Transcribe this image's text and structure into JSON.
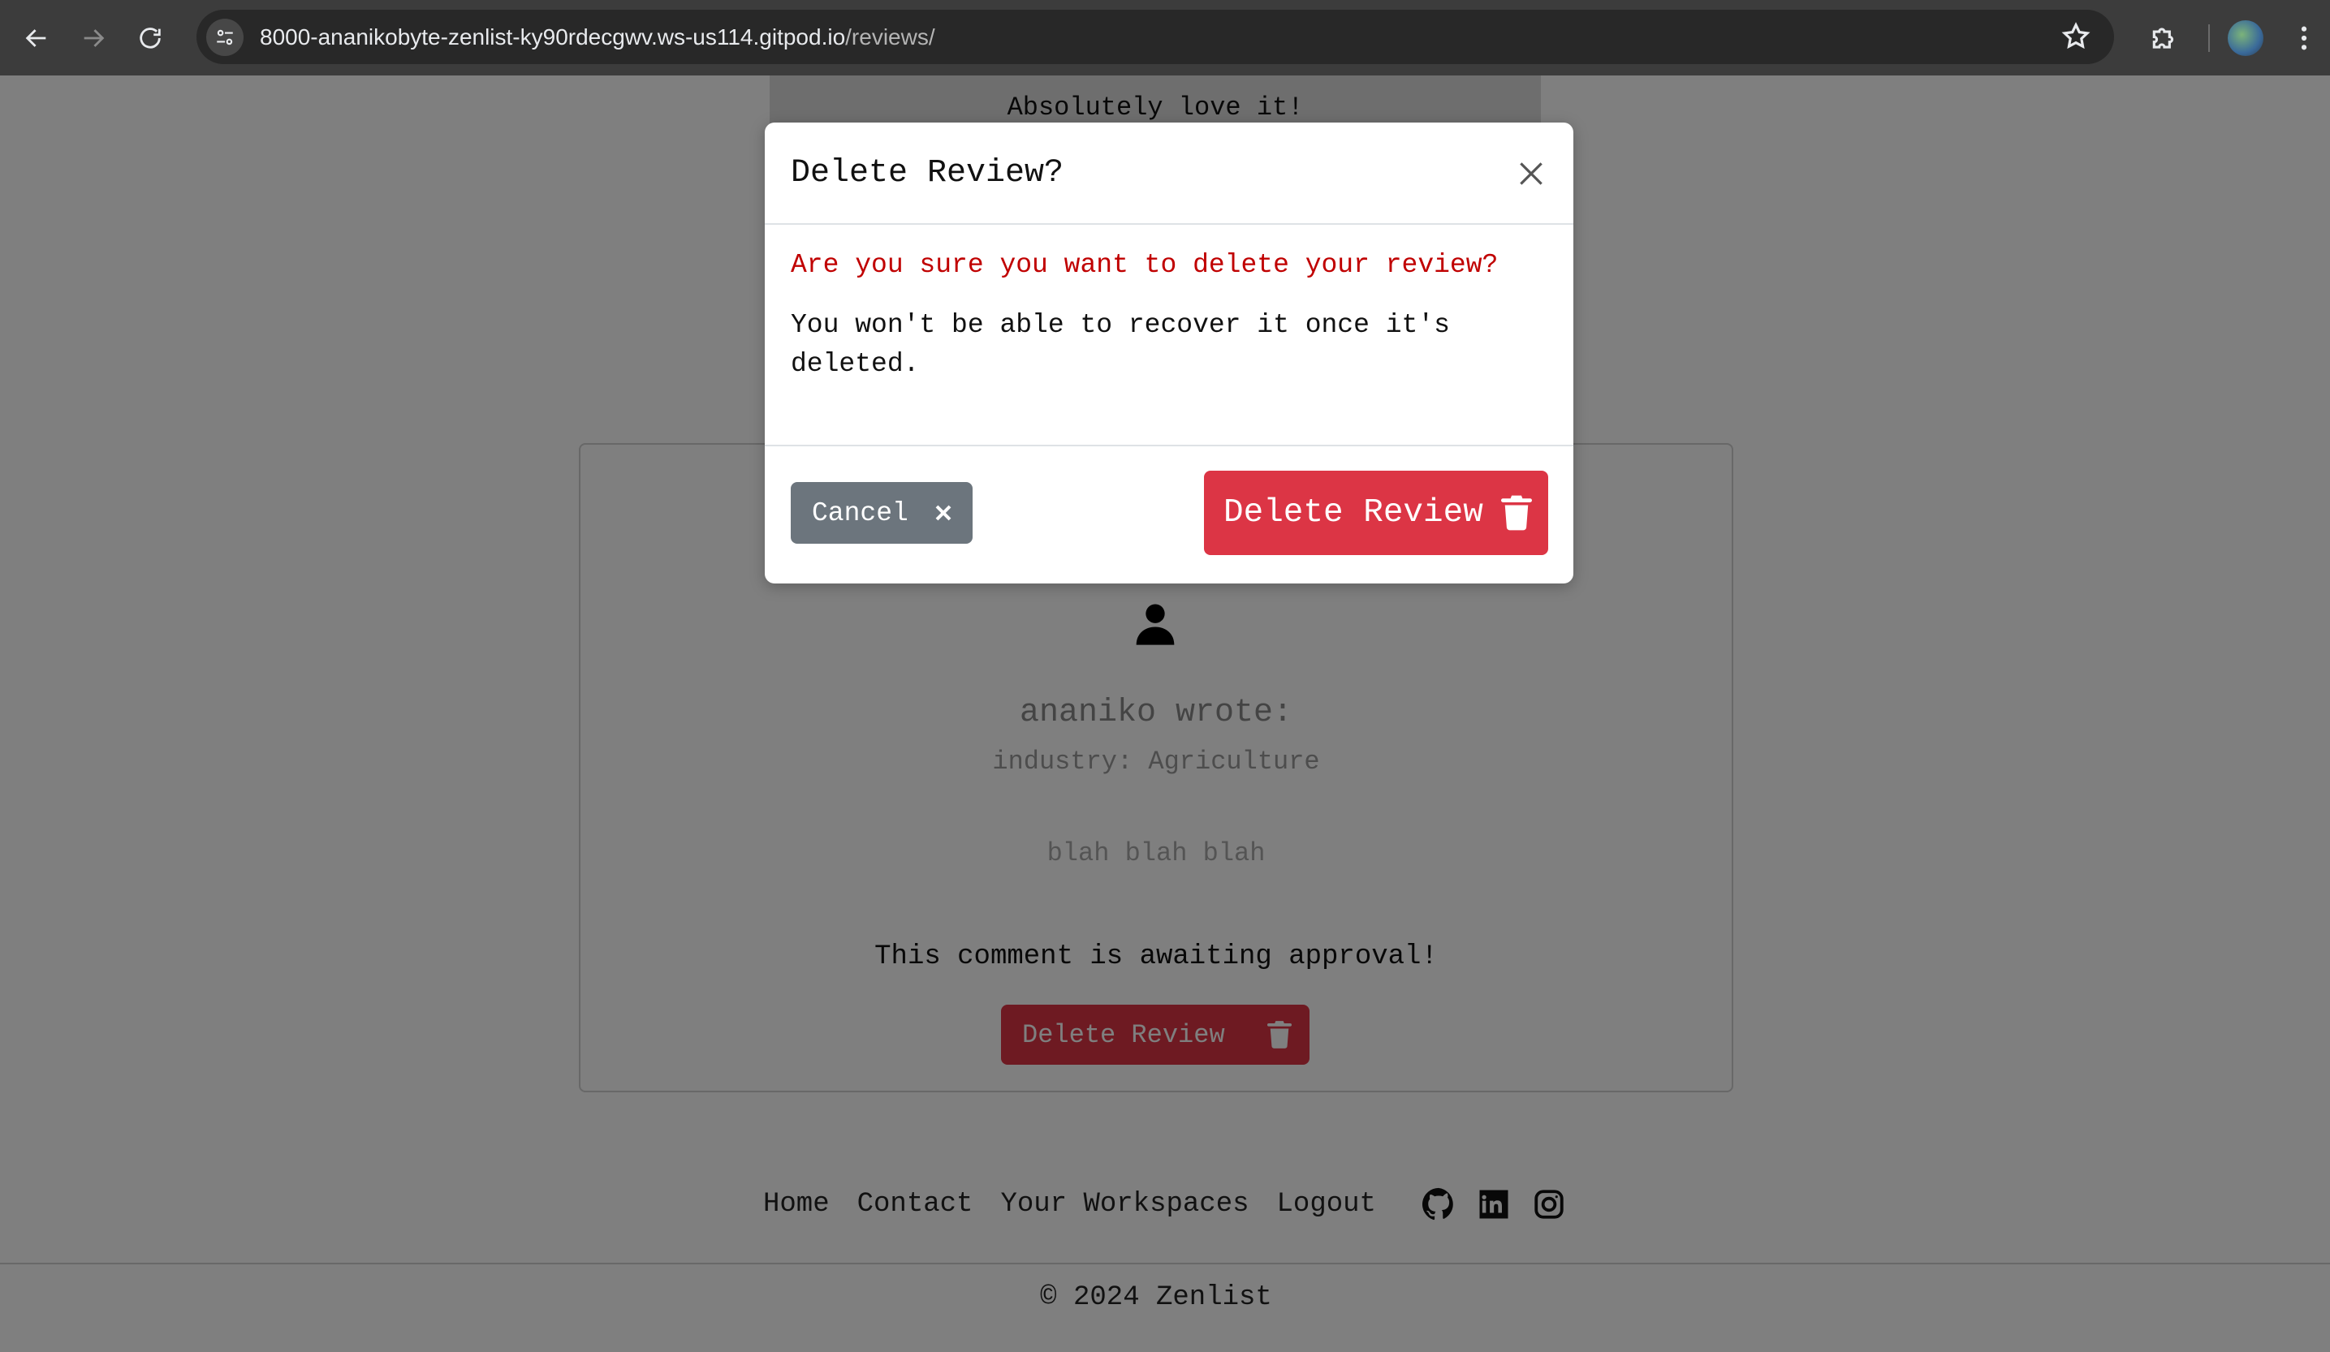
{
  "browser": {
    "url_host": "8000-ananikobyte-zenlist-ky90rdecgwv.ws-us114.gitpod.io",
    "url_path": "/reviews/",
    "icons": [
      "back-arrow-icon",
      "forward-arrow-icon",
      "reload-icon",
      "site-info-icon",
      "bookmark-star-icon",
      "extensions-puzzle-icon",
      "profile-avatar",
      "more-menu-icon"
    ]
  },
  "page": {
    "previous_review_text": "Absolutely love it!",
    "review": {
      "author": "ananiko wrote:",
      "industry": "industry: Agriculture",
      "body": "blah blah blah",
      "status": "This comment is awaiting approval!",
      "delete_label": "Delete Review"
    },
    "footer": {
      "links": [
        "Home",
        "Contact",
        "Your Workspaces",
        "Logout"
      ],
      "social_icons": [
        "github-icon",
        "linkedin-icon",
        "instagram-icon"
      ],
      "copyright": "© 2024 Zenlist"
    }
  },
  "modal": {
    "title": "Delete Review?",
    "warning": "Are you sure you want to delete your review?",
    "detail": "You won't be able to recover it once it's deleted.",
    "cancel_label": "Cancel",
    "delete_label": "Delete Review",
    "colors": {
      "danger": "#dc3545",
      "secondary": "#6c757d",
      "warning_text": "#c00000"
    }
  }
}
